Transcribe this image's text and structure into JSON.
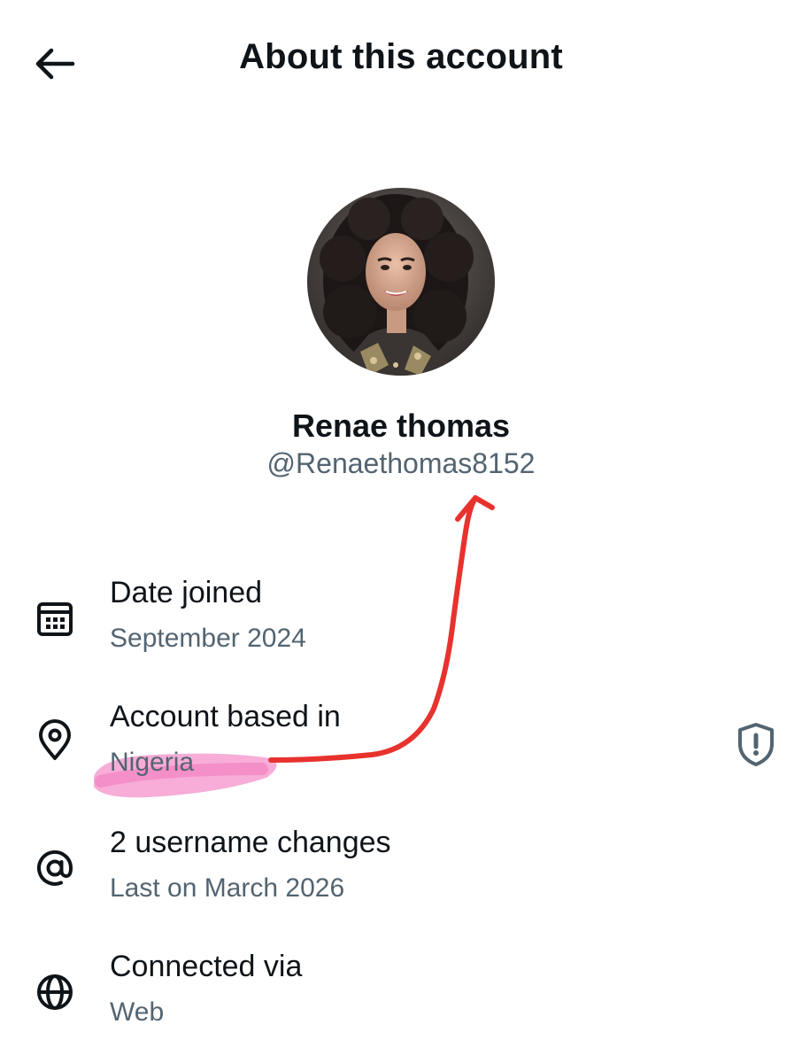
{
  "header": {
    "title": "About this account",
    "back_icon": "arrow-left-icon"
  },
  "profile": {
    "display_name": "Renae thomas",
    "handle": "@Renaethomas8152",
    "avatar_icon": "avatar"
  },
  "rows": [
    {
      "icon": "calendar-icon",
      "title": "Date joined",
      "value": "September 2024"
    },
    {
      "icon": "location-pin-icon",
      "title": "Account based in",
      "value": "Nigeria",
      "action_icon": "shield-alert-icon"
    },
    {
      "icon": "at-sign-icon",
      "title": "2 username changes",
      "value": "Last on March 2026"
    },
    {
      "icon": "globe-icon",
      "title": "Connected via",
      "value": "Web"
    }
  ],
  "annotation": {
    "highlight_color": "#f06ab8",
    "arrow_color": "#e8322e"
  },
  "colors": {
    "primary_text": "#0f1419",
    "secondary_text": "#536471",
    "background": "#ffffff"
  }
}
